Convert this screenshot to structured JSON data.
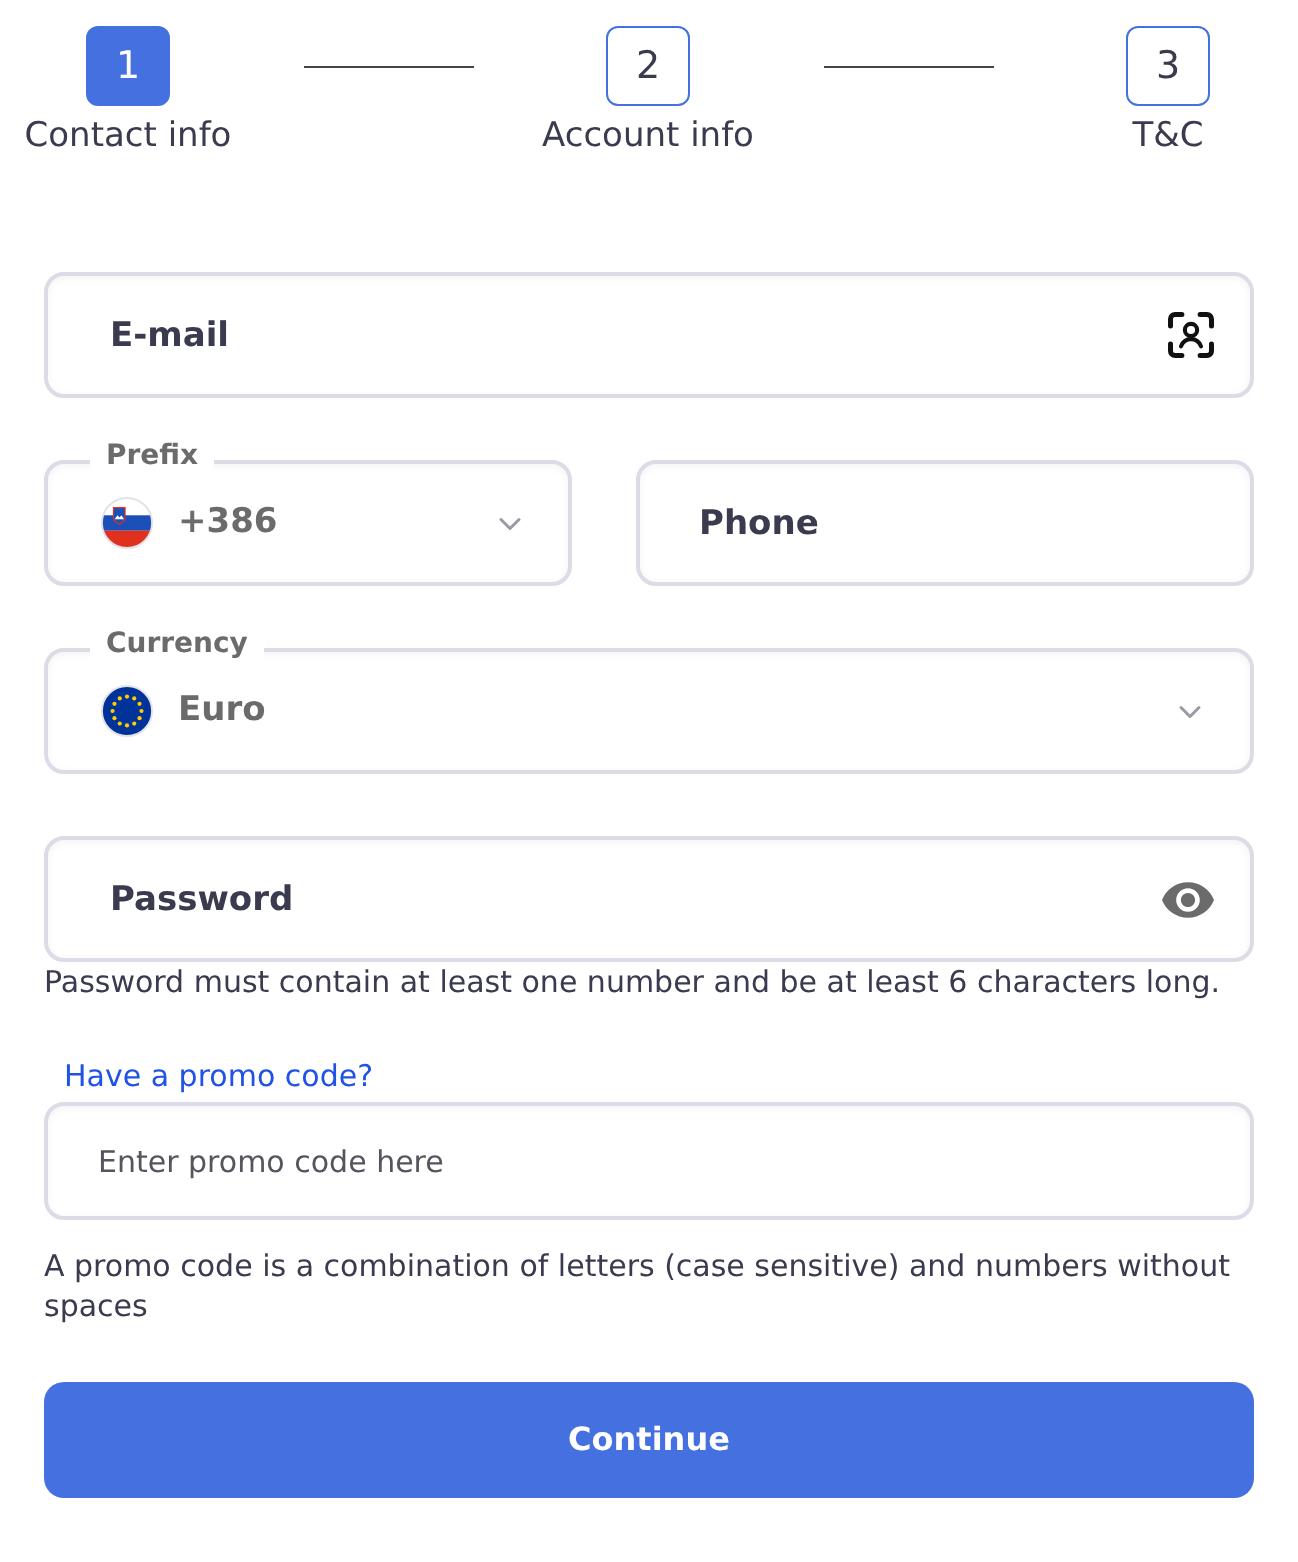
{
  "stepper": {
    "steps": [
      {
        "number": "1",
        "label": "Contact info",
        "selected": true
      },
      {
        "number": "2",
        "label": "Account info",
        "selected": false
      },
      {
        "number": "3",
        "label": "T&C",
        "selected": false
      }
    ]
  },
  "form": {
    "email": {
      "placeholder": "E-mail"
    },
    "prefix": {
      "label": "Prefix",
      "value": "+386"
    },
    "phone": {
      "placeholder": "Phone"
    },
    "currency": {
      "label": "Currency",
      "value": "Euro"
    },
    "password": {
      "placeholder": "Password"
    },
    "password_hint": "Password must contain at least one number and be at least 6 characters long.",
    "promo_link": "Have a promo code?",
    "promo": {
      "placeholder": "Enter promo code here"
    },
    "promo_hint": "A promo code is a combination of letters (case sensitive) and numbers without spaces",
    "continue_button": "Continue"
  }
}
